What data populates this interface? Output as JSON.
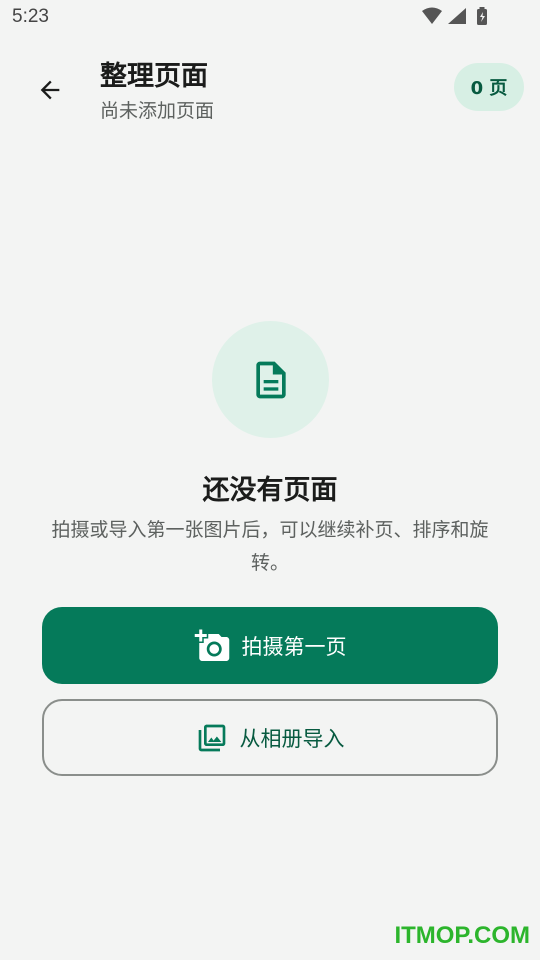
{
  "status_bar": {
    "time": "5:23",
    "icons": [
      "wifi-icon",
      "signal-icon",
      "battery-icon"
    ]
  },
  "app_bar": {
    "back_icon": "arrow-left-icon",
    "title": "整理页面",
    "subtitle": "尚未添加页面",
    "page_count_label": "0 页"
  },
  "empty_state": {
    "icon": "document-icon",
    "title": "还没有页面",
    "description": "拍摄或导入第一张图片后，可以继续补页、排序和旋转。"
  },
  "actions": {
    "capture_label": "拍摄第一页",
    "capture_icon": "add-camera-icon",
    "import_label": "从相册导入",
    "import_icon": "photo-library-icon"
  },
  "watermark": "ITMOP.COM",
  "colors": {
    "accent": "#057a5a",
    "accent_soft": "#dff1e9",
    "badge_bg": "#d7efe4",
    "background": "#f3f4f3",
    "watermark": "#2cb52c"
  }
}
